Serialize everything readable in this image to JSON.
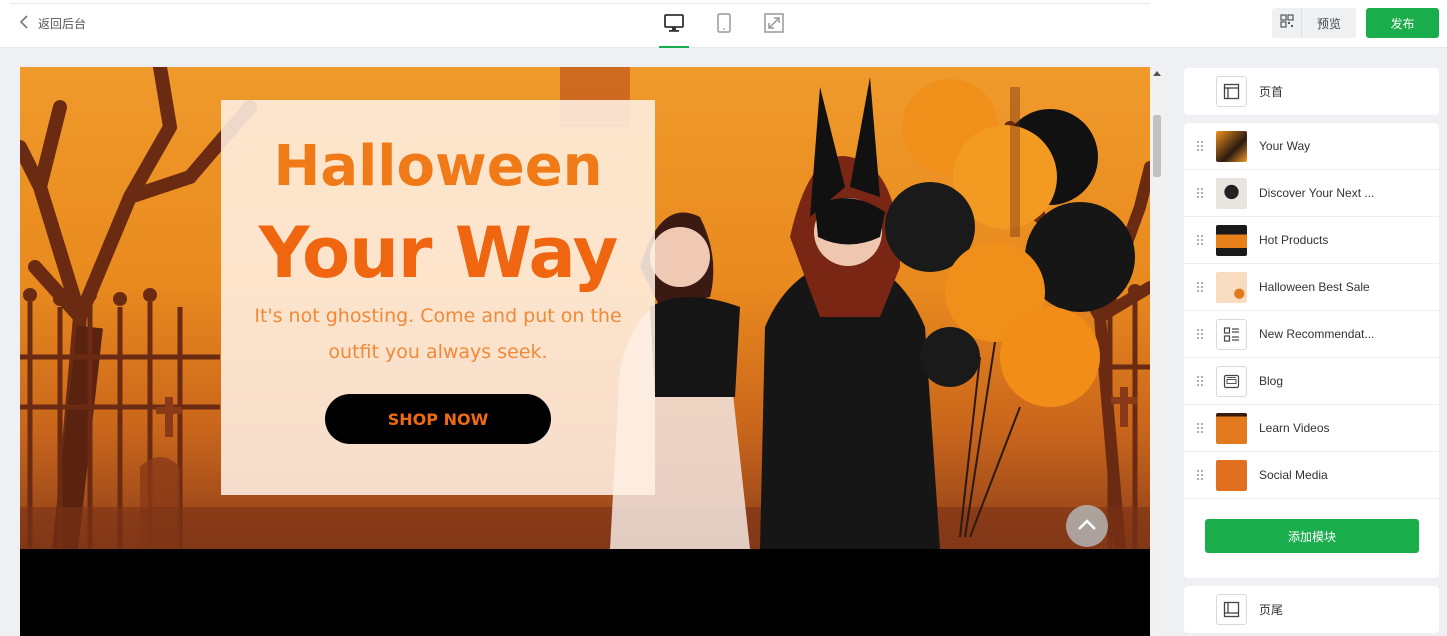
{
  "topbar": {
    "back_label": "返回后台",
    "devices": [
      "desktop-icon",
      "tablet-icon",
      "fullscreen-icon"
    ],
    "active_device": "desktop",
    "preview_label": "预览",
    "publish_label": "发布"
  },
  "banner": {
    "title_line1": "Halloween",
    "title_line2": "Your Way",
    "subtitle": "It's not ghosting. Come and put on the outfit you always seek.",
    "cta_label": "SHOP NOW"
  },
  "panel": {
    "header_label": "页首",
    "footer_label": "页尾",
    "modules": [
      {
        "label": "Your Way",
        "thumb": "image"
      },
      {
        "label": "Discover Your Next ...",
        "thumb": "image"
      },
      {
        "label": "Hot Products",
        "thumb": "image"
      },
      {
        "label": "Halloween Best Sale",
        "thumb": "image"
      },
      {
        "label": "New Recommendat...",
        "thumb": "list-icon"
      },
      {
        "label": "Blog",
        "thumb": "blog-icon"
      },
      {
        "label": "Learn Videos",
        "thumb": "image"
      },
      {
        "label": "Social Media",
        "thumb": "image"
      }
    ],
    "add_module_label": "添加模块"
  },
  "colors": {
    "accent": "#1aad4b",
    "banner_orange": "#f07a18",
    "cta_bg": "#000000"
  }
}
